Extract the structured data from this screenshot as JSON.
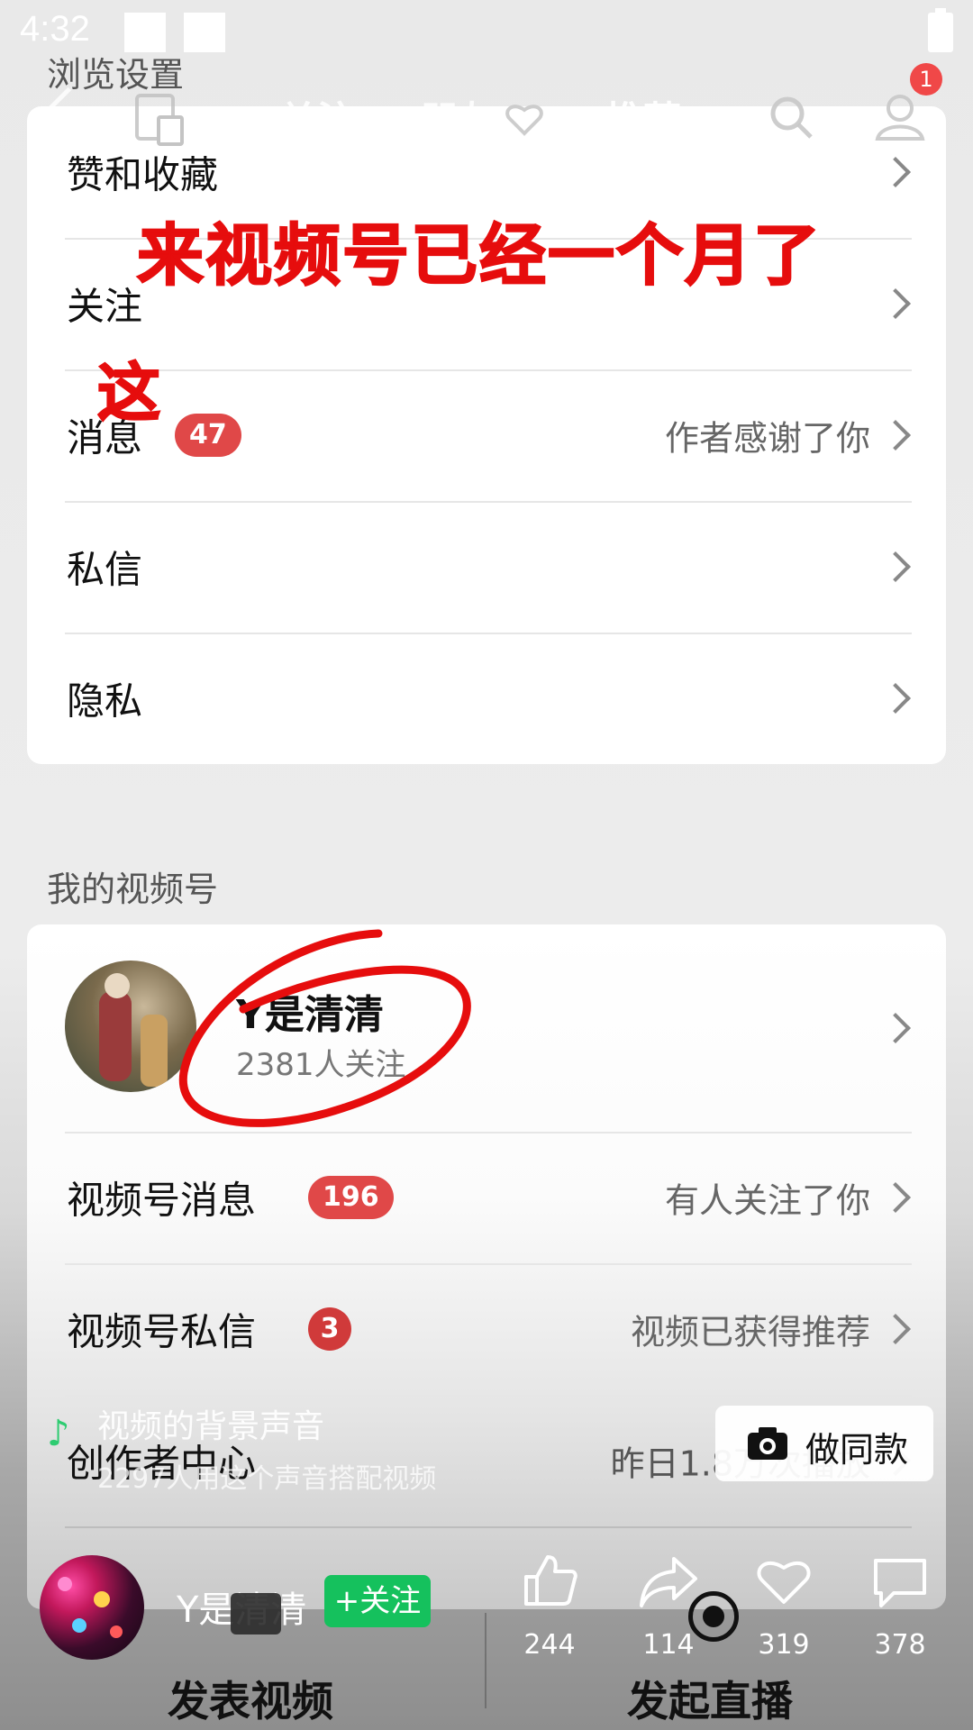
{
  "status_bar": {
    "time": "4:32"
  },
  "top_nav": {
    "tabs": [
      "关注",
      "朋友",
      "推荐"
    ],
    "active_tab": "推荐",
    "notification_count": "1"
  },
  "annotations": {
    "headline": "来视频号已经一个月了",
    "side": "这"
  },
  "browse_settings": {
    "section_title": "浏览设置",
    "rows": [
      {
        "label": "赞和收藏",
        "badge": "",
        "right": ""
      },
      {
        "label": "关注",
        "badge": "",
        "right": ""
      },
      {
        "label": "消息",
        "badge": "47",
        "right": "作者感谢了你"
      },
      {
        "label": "私信",
        "badge": "",
        "right": ""
      },
      {
        "label": "隐私",
        "badge": "",
        "right": ""
      }
    ]
  },
  "my_channel": {
    "section_title": "我的视频号",
    "profile": {
      "name": "Y是清清",
      "followers": "2381人关注"
    },
    "rows": [
      {
        "label": "视频号消息",
        "badge": "196",
        "right": "有人关注了你"
      },
      {
        "label": "视频号私信",
        "badge": "3",
        "right": "视频已获得推荐"
      },
      {
        "label": "创作者中心",
        "badge": "",
        "right": "昨日1.8万次播放"
      }
    ]
  },
  "music": {
    "title": "视频的背景声音",
    "subtitle": "2297人用这个声音搭配视频",
    "make_same": "做同款"
  },
  "video_footer": {
    "author": "Y是清清",
    "follow_label": "+关注",
    "likes": "244",
    "shares": "114",
    "favorites": "319",
    "comments": "378"
  },
  "bottom_actions": {
    "publish": "发表视频",
    "live": "发起直播"
  },
  "colors": {
    "badge_red": "#e04848",
    "annotation_red": "#e60d0d",
    "follow_green": "#15c15d"
  }
}
